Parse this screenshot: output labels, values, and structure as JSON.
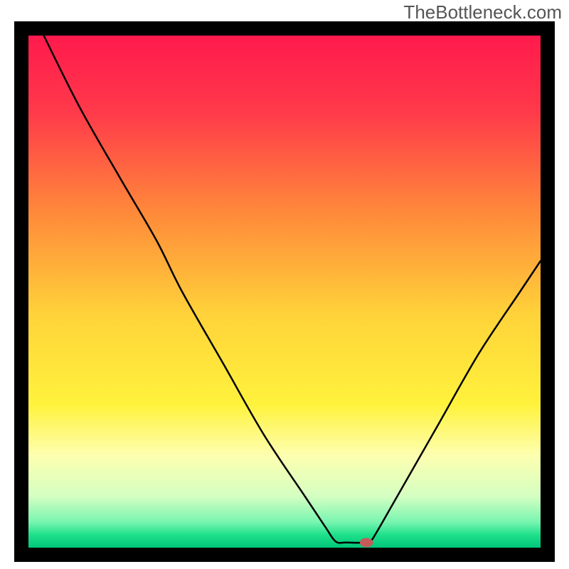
{
  "watermark": "TheBottleneck.com",
  "chart_data": {
    "type": "line",
    "title": "",
    "xlabel": "",
    "ylabel": "",
    "xlim": [
      0,
      100
    ],
    "ylim": [
      0,
      100
    ],
    "background": {
      "type": "vertical-gradient",
      "stops": [
        {
          "offset": 0.0,
          "color": "#ff1a4d"
        },
        {
          "offset": 0.15,
          "color": "#ff3a4a"
        },
        {
          "offset": 0.35,
          "color": "#ff8b3a"
        },
        {
          "offset": 0.55,
          "color": "#ffd43a"
        },
        {
          "offset": 0.72,
          "color": "#fff23c"
        },
        {
          "offset": 0.82,
          "color": "#fdffb0"
        },
        {
          "offset": 0.9,
          "color": "#d4ffc2"
        },
        {
          "offset": 0.95,
          "color": "#78f5b0"
        },
        {
          "offset": 0.975,
          "color": "#1fe08a"
        },
        {
          "offset": 1.0,
          "color": "#00c77a"
        }
      ]
    },
    "black_border_px": 20,
    "series": [
      {
        "name": "bottleneck-curve",
        "color": "#000000",
        "width": 2.5,
        "points": [
          {
            "x": 3,
            "y": 100
          },
          {
            "x": 10,
            "y": 86
          },
          {
            "x": 18,
            "y": 72
          },
          {
            "x": 25,
            "y": 60
          },
          {
            "x": 30,
            "y": 50
          },
          {
            "x": 38,
            "y": 36
          },
          {
            "x": 46,
            "y": 22
          },
          {
            "x": 54,
            "y": 10
          },
          {
            "x": 58,
            "y": 4
          },
          {
            "x": 60,
            "y": 1.2
          },
          {
            "x": 62,
            "y": 1.0
          },
          {
            "x": 66,
            "y": 1.0
          },
          {
            "x": 67,
            "y": 1.4
          },
          {
            "x": 72,
            "y": 10
          },
          {
            "x": 80,
            "y": 24
          },
          {
            "x": 88,
            "y": 38
          },
          {
            "x": 96,
            "y": 50
          },
          {
            "x": 100,
            "y": 56
          }
        ]
      }
    ],
    "marker": {
      "name": "optimal-point",
      "x": 66,
      "y": 1.0,
      "rx": 1.3,
      "ry": 0.9,
      "color": "#c45a5a"
    }
  }
}
